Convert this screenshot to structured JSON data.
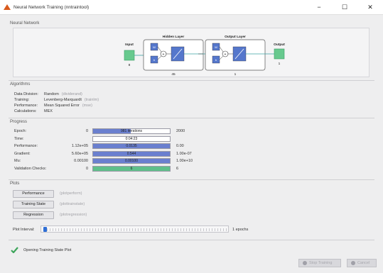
{
  "window": {
    "title": "Neural Network Training (nntraintool)",
    "controls": {
      "minimize": "−",
      "maximize": "☐",
      "close": "✕"
    }
  },
  "sections": {
    "network": "Neural Network",
    "algorithms": "Algorithms",
    "progress": "Progress",
    "plots": "Plots"
  },
  "network": {
    "input_label": "Input",
    "input_size": "8",
    "hidden_title": "Hidden Layer",
    "hidden_size": "45",
    "output_title": "Output Layer",
    "output_layer_size": "1",
    "output_label": "Output",
    "output_size": "1",
    "w": "W",
    "b": "b"
  },
  "algorithms": [
    {
      "key": "Data Division:",
      "value": "Random",
      "paren": "(dividerand)"
    },
    {
      "key": "Training:",
      "value": "Levenberg-Marquardt",
      "paren": "(trainlm)"
    },
    {
      "key": "Performance:",
      "value": "Mean Squared Error",
      "paren": "(mse)"
    },
    {
      "key": "Calculations:",
      "value": "MEX",
      "paren": ""
    }
  ],
  "progress": [
    {
      "label": "Epoch:",
      "min": "0",
      "bar_text": "981 iterations",
      "max": "2000",
      "fill": 0.49,
      "color": "blue"
    },
    {
      "label": "Time:",
      "min": "",
      "bar_text": "0:04:23",
      "max": "",
      "fill": 0.0,
      "color": "blue"
    },
    {
      "label": "Performance:",
      "min": "1.12e+05",
      "bar_text": "0.0135",
      "max": "0.00",
      "fill": 1.0,
      "color": "blue"
    },
    {
      "label": "Gradient:",
      "min": "5.60e+05",
      "bar_text": "0.544",
      "max": "1.00e-07",
      "fill": 1.0,
      "color": "blue"
    },
    {
      "label": "Mu:",
      "min": "0.00100",
      "bar_text": "0.00100",
      "max": "1.00e+10",
      "fill": 1.0,
      "color": "blue"
    },
    {
      "label": "Validation Checks:",
      "min": "0",
      "bar_text": "6",
      "max": "6",
      "fill": 1.0,
      "color": "green"
    }
  ],
  "plots": {
    "buttons": [
      {
        "label": "Performance",
        "paren": "(plotperform)"
      },
      {
        "label": "Training State",
        "paren": "(plottrainstate)"
      },
      {
        "label": "Regression",
        "paren": "(plotregression)"
      }
    ],
    "interval_label": "Plot Interval:",
    "interval_value": "1 epochs"
  },
  "status": {
    "text": "Opening Training State Plot",
    "stop_label": "Stop Training",
    "cancel_label": "Cancel"
  },
  "colors": {
    "accent": "#6a7fcf",
    "success": "#5fbf8a",
    "diagram_green": "#67c98e"
  }
}
